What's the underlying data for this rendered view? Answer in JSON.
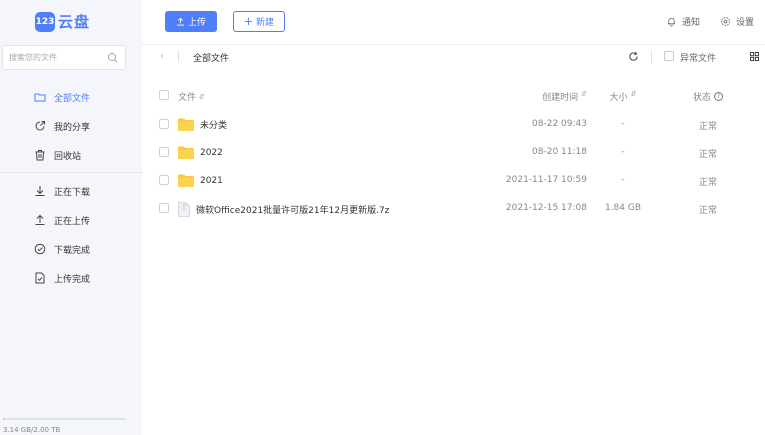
{
  "app": {
    "logo_mark": "123",
    "logo_text": "云盘",
    "brand_color": "#4f7ef8"
  },
  "sidebar": {
    "search_placeholder": "搜索您的文件",
    "items": [
      {
        "label": "全部文件",
        "icon": "folder-icon",
        "active": true
      },
      {
        "label": "我的分享",
        "icon": "share-icon"
      },
      {
        "label": "回收站",
        "icon": "trash-icon"
      },
      {
        "label": "正在下载",
        "icon": "download-icon"
      },
      {
        "label": "正在上传",
        "icon": "upload-icon"
      },
      {
        "label": "下载完成",
        "icon": "check-circle-icon"
      },
      {
        "label": "上传完成",
        "icon": "file-check-icon"
      }
    ],
    "storage_text": "3.14 GB/2.00 TB",
    "storage_used_fraction": 0.0016
  },
  "header": {
    "upload_label": "上传",
    "new_label": "新建",
    "notify_label": "通知",
    "settings_label": "设置"
  },
  "toolbar": {
    "breadcrumb": "全部文件",
    "abnormal_label": "异常文件"
  },
  "table": {
    "headers": {
      "name": "文件",
      "time": "创建时间",
      "size": "大小",
      "status": "状态"
    },
    "rows": [
      {
        "name": "未分类",
        "type": "folder",
        "time": "08-22 09:43",
        "size": "-",
        "status": "正常"
      },
      {
        "name": "2022",
        "type": "folder",
        "time": "08-20 11:18",
        "size": "-",
        "status": "正常"
      },
      {
        "name": "2021",
        "type": "folder",
        "time": "2021-11-17 10:59",
        "size": "-",
        "status": "正常"
      },
      {
        "name": "微软Office2021批量许可版21年12月更新版.7z",
        "type": "file",
        "time": "2021-12-15 17:08",
        "size": "1.84 GB",
        "status": "正常"
      }
    ]
  }
}
